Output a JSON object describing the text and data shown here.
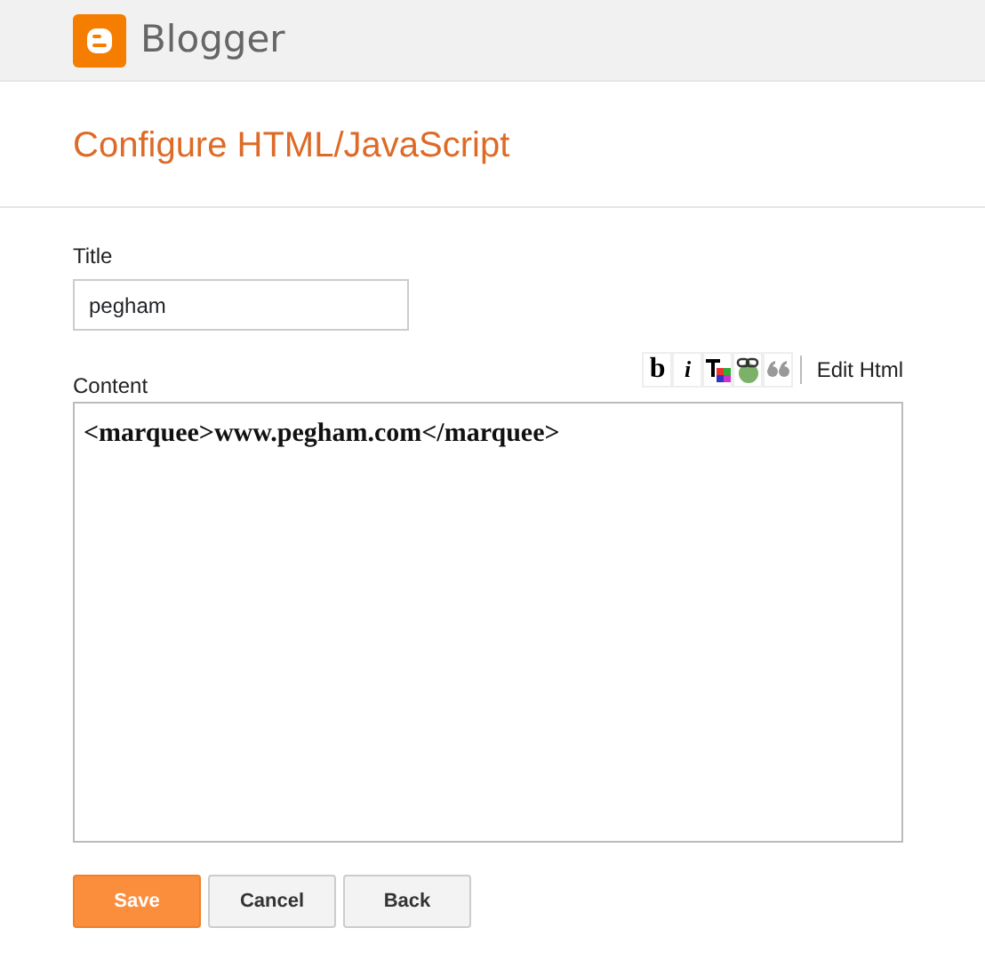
{
  "brand": "Blogger",
  "heading": "Configure HTML/JavaScript",
  "title_field": {
    "label": "Title",
    "value": "pegham"
  },
  "content_field": {
    "label": "Content",
    "value": "<marquee>www.pegham.com</marquee>"
  },
  "toolbar": [
    {
      "kind": "bold",
      "label": "b"
    },
    {
      "kind": "italic",
      "label": "i"
    },
    {
      "kind": "color"
    },
    {
      "kind": "link"
    },
    {
      "kind": "quote"
    }
  ],
  "edit_html": "Edit Html",
  "buttons": [
    {
      "label": "Save",
      "kind": "primary"
    },
    {
      "label": "Cancel",
      "kind": "secondary"
    },
    {
      "label": "Back",
      "kind": "secondary"
    }
  ]
}
